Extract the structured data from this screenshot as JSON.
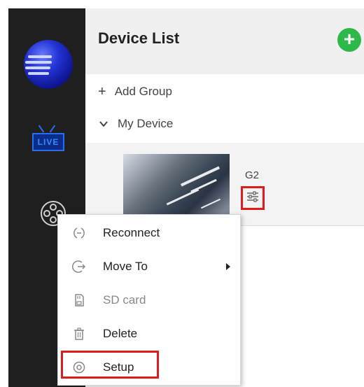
{
  "sidebar": {
    "logo": "globe-logo",
    "items": [
      {
        "name": "live-icon",
        "label": "LIVE"
      },
      {
        "name": "film-reel-icon"
      }
    ]
  },
  "header": {
    "title": "Device List",
    "add_icon": "plus-circle-icon"
  },
  "groups": {
    "add_group": {
      "icon": "+",
      "label": "Add Group"
    },
    "my_device": {
      "icon": "chevron-down-icon",
      "label": "My Device"
    }
  },
  "device": {
    "name": "G2",
    "settings_icon": "sliders-icon"
  },
  "context_menu": {
    "items": [
      {
        "label": "Reconnect",
        "icon": "reconnect-icon",
        "enabled": true
      },
      {
        "label": "Move To",
        "icon": "move-icon",
        "enabled": true,
        "submenu": true
      },
      {
        "label": "SD card",
        "icon": "sd-card-icon",
        "enabled": false
      },
      {
        "label": "Delete",
        "icon": "trash-icon",
        "enabled": true
      },
      {
        "label": "Setup",
        "icon": "gear-icon",
        "enabled": true,
        "highlighted": true
      }
    ]
  },
  "colors": {
    "sidebar_bg": "#1f1f1f",
    "accent_green": "#2fb84a",
    "highlight_red": "#e01b1b",
    "live_blue": "#2a6df0"
  }
}
